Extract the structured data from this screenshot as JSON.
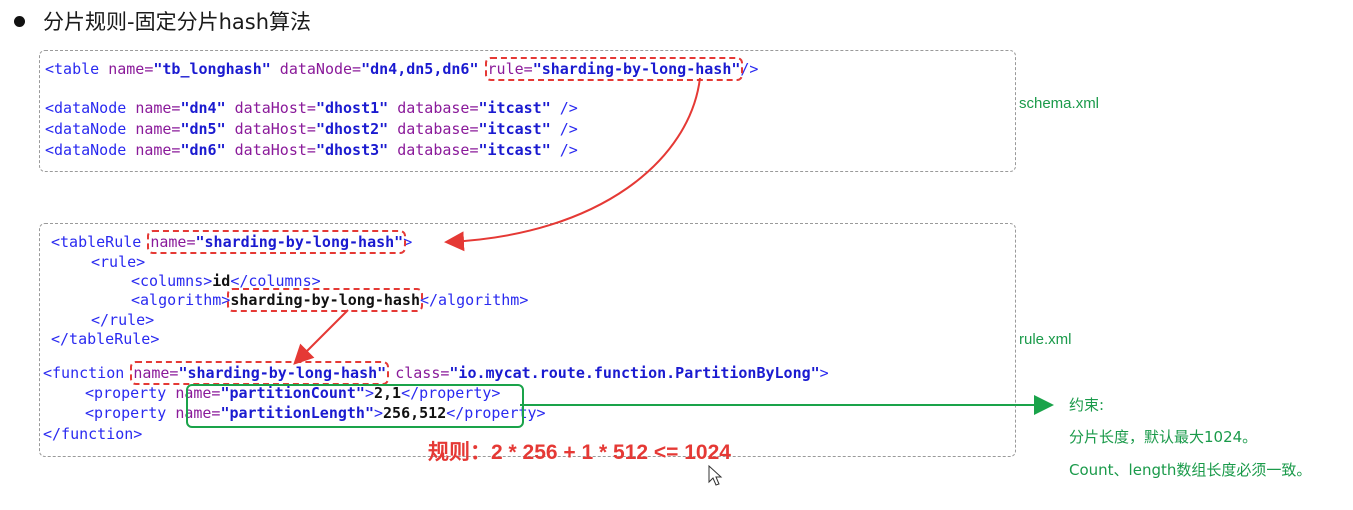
{
  "heading": {
    "title": "分片规则-固定分片hash算法"
  },
  "schema": {
    "file_label": "schema.xml",
    "table_line": {
      "open": "<table ",
      "name_attr": "name=",
      "name_val": "\"tb_longhash\"",
      "dn_attr": " dataNode=",
      "dn_val": "\"dn4,dn5,dn6\"",
      "rule_attr": "rule=",
      "rule_val": "\"sharding-by-long-hash\"",
      "close": "/>"
    },
    "datanodes": [
      {
        "name": "\"dn4\"",
        "host": "\"dhost1\"",
        "db": "\"itcast\""
      },
      {
        "name": "\"dn5\"",
        "host": "\"dhost2\"",
        "db": "\"itcast\""
      },
      {
        "name": "\"dn6\"",
        "host": "\"dhost3\"",
        "db": "\"itcast\""
      }
    ]
  },
  "rulexml": {
    "file_label": "rule.xml",
    "tablerule_open": "<tableRule ",
    "tablerule_name_attr": "name=",
    "tablerule_name_val": "\"sharding-by-long-hash\"",
    "tablerule_gt": ">",
    "rule_open": "<rule>",
    "columns_open": "<columns>",
    "columns_val": "id",
    "columns_close": "</columns>",
    "algorithm_open": "<algorithm>",
    "algorithm_val": "sharding-by-long-hash",
    "algorithm_close": "</algorithm>",
    "rule_close": "</rule>",
    "tablerule_close": "</tableRule>",
    "function_open": "<function ",
    "function_name_attr": "name=",
    "function_name_val": "\"sharding-by-long-hash\"",
    "function_class_attr": " class=",
    "function_class_val": "\"io.mycat.route.function.PartitionByLong\"",
    "function_gt": ">",
    "property_open": "<property ",
    "prop1_attr": "name=",
    "prop1_name": "\"partitionCount\"",
    "prop1_value": "2,1",
    "prop2_attr": "name=",
    "prop2_name": "\"partitionLength\"",
    "prop2_value": "256,512",
    "property_close": "</property>",
    "function_close": "</function>"
  },
  "annotation": {
    "rule_formula": "规则：2 * 256 + 1 * 512 <= 1024",
    "constraint_title": "约束:",
    "constraint_line1": "分片长度，默认最大1024。",
    "constraint_line2": "Count、length数组长度必须一致。"
  },
  "colors": {
    "red": "#e53935",
    "green": "#1aa34a",
    "tag_blue": "#2a2af0",
    "attr_purple": "#8a1a9a"
  }
}
